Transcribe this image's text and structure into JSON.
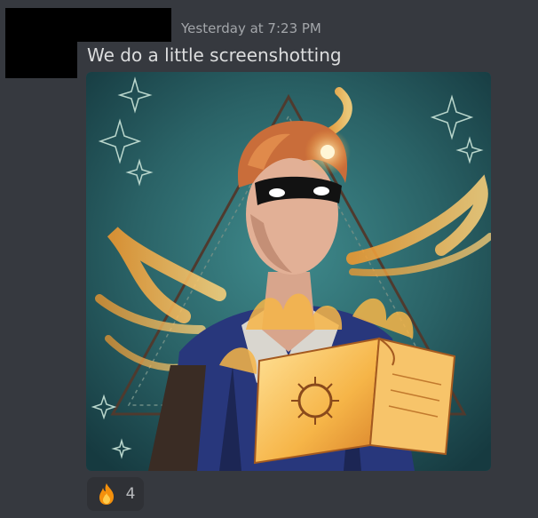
{
  "message": {
    "timestamp": "Yesterday at 7:23 PM",
    "text": "We do a little screenshotting",
    "attachment_icon": "artwork-image",
    "reactions": [
      {
        "emoji": "fire-emoji",
        "count": "4"
      }
    ]
  },
  "colors": {
    "background": "#36393f",
    "timestamp": "#a3a6aa",
    "message_text": "#dcddde",
    "reaction_bg": "#2f3136",
    "reaction_count": "#b9bbbe",
    "redaction": "#000000"
  }
}
